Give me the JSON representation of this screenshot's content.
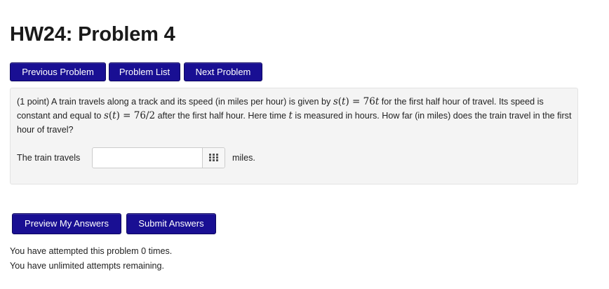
{
  "header": {
    "title": "HW24: Problem 4"
  },
  "nav": {
    "previous_label": "Previous Problem",
    "list_label": "Problem List",
    "next_label": "Next Problem"
  },
  "problem": {
    "points": "(1 point)",
    "text_1": "A train travels along a track and its speed (in miles per hour) is given by",
    "math_1": "s(t) = 76t",
    "text_2": "for the first half hour of travel. Its speed is constant and equal to",
    "math_2": "s(t) = 76/2",
    "text_3": "after the first half hour. Here time",
    "math_3": "t",
    "text_4": "is measured in hours. How far (in miles) does the train travel in the first hour of travel?",
    "answer_label": "The train travels",
    "answer_value": "",
    "answer_placeholder": "",
    "answer_unit": "miles.",
    "palette_icon": "grid-icon"
  },
  "actions": {
    "preview_label": "Preview My Answers",
    "submit_label": "Submit Answers"
  },
  "status": {
    "attempted": "You have attempted this problem 0 times.",
    "remaining": "You have unlimited attempts remaining."
  },
  "colors": {
    "button_bg": "#190f93",
    "box_bg": "#f4f4f4"
  }
}
